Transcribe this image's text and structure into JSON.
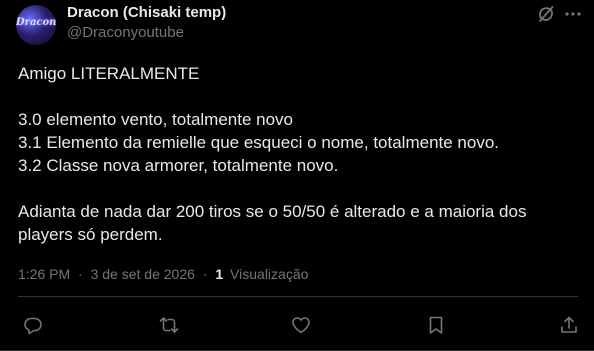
{
  "author": {
    "avatar_text": "Dracon",
    "display_name": "Dracon (Chisaki temp)",
    "handle": "@Draconyoutube"
  },
  "post": {
    "lines": [
      "Amigo LITERALMENTE",
      "",
      "3.0 elemento vento, totalmente novo",
      "3.1 Elemento da remielle que esqueci o nome, totalmente novo.",
      "3.2 Classe nova armorer, totalmente novo.",
      "",
      "Adianta de nada dar 200 tiros se o 50/50 é alterado e a maioria dos",
      "players só perdem."
    ],
    "time": "1:26 PM",
    "separator": "·",
    "date": "3 de set de 2026",
    "views_count": "1",
    "views_label": "Visualização"
  },
  "icons": {
    "grok": "grok-icon",
    "more": "more-icon",
    "reply": "reply-icon",
    "repost": "repost-icon",
    "like": "like-icon",
    "bookmark": "bookmark-icon",
    "share": "share-icon"
  },
  "colors": {
    "background": "#000000",
    "text": "#e7e9ea",
    "muted": "#71767b",
    "border": "#2f3336"
  }
}
